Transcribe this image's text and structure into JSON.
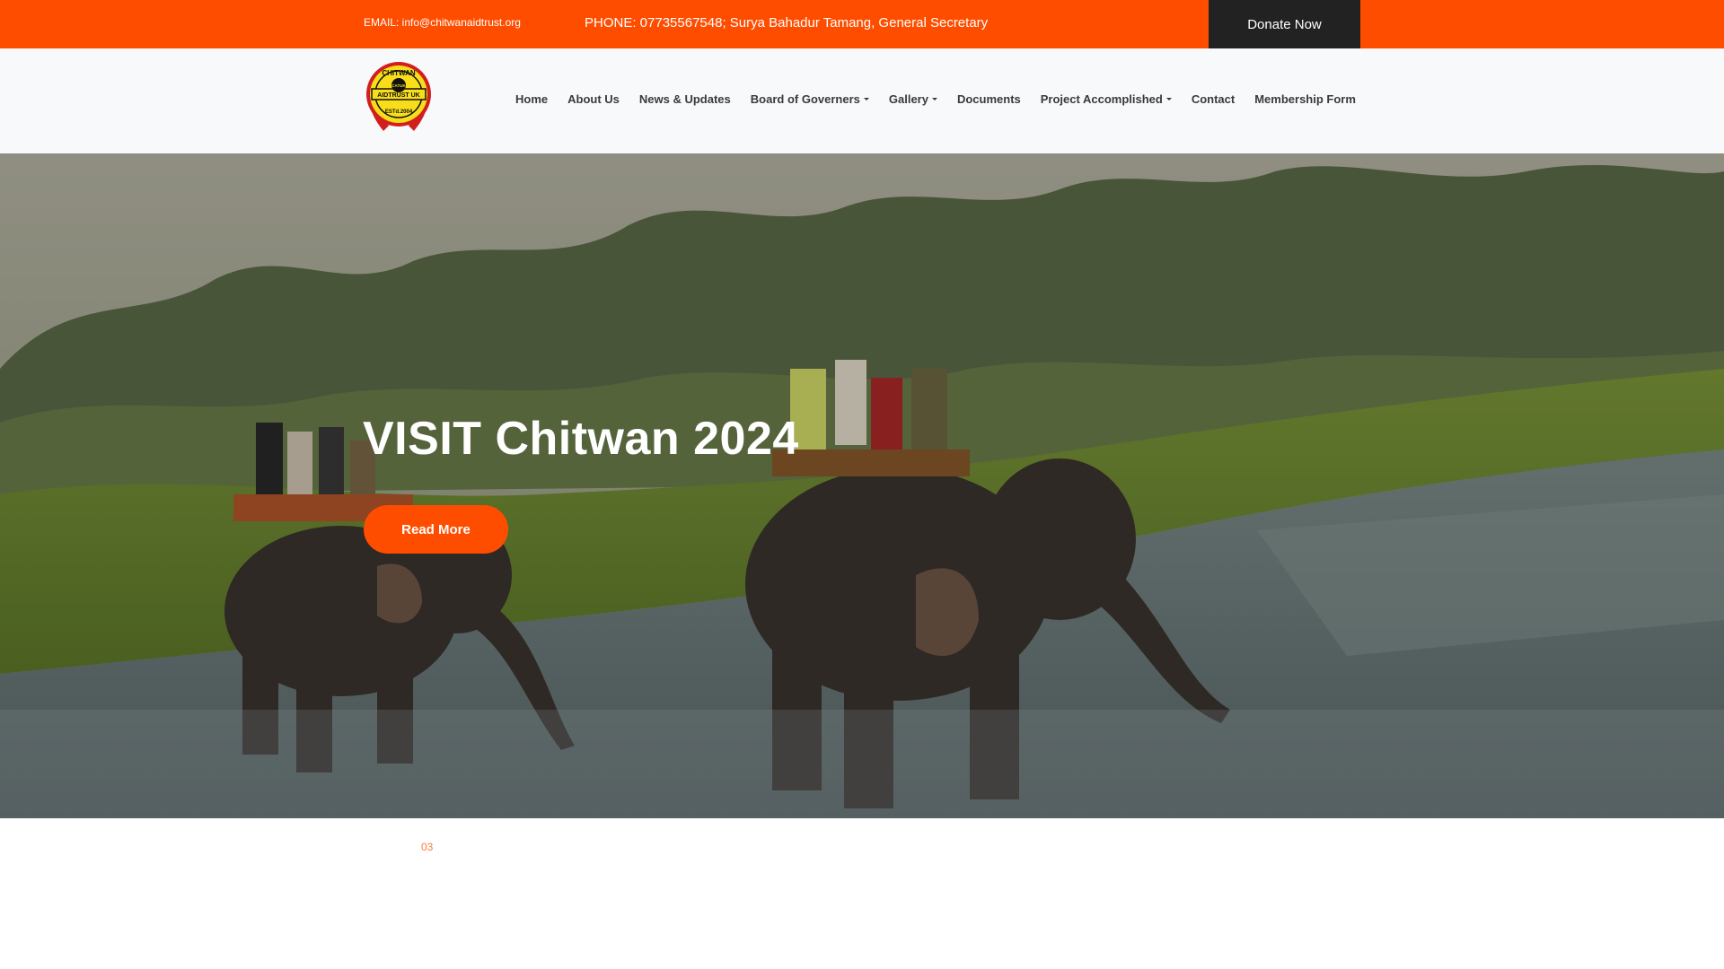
{
  "topbar": {
    "email": "EMAIL: info@chitwanaidtrust.org",
    "phone": "PHONE: 07735567548; Surya Bahadur Tamang, General Secretary",
    "donate_label": "Donate Now"
  },
  "logo": {
    "top_text": "CHITWAN",
    "middle_text": "CATUK",
    "band_text": "AIDTRUST UK",
    "bottom_text": "ESTd.2004"
  },
  "nav": {
    "items": [
      {
        "label": "Home",
        "dropdown": false
      },
      {
        "label": "About Us",
        "dropdown": false
      },
      {
        "label": "News & Updates",
        "dropdown": false
      },
      {
        "label": "Board of Governers",
        "dropdown": true
      },
      {
        "label": "Gallery",
        "dropdown": true
      },
      {
        "label": "Documents",
        "dropdown": false
      },
      {
        "label": "Project Accomplished",
        "dropdown": true
      },
      {
        "label": "Contact",
        "dropdown": false
      },
      {
        "label": "Membership Form",
        "dropdown": false
      }
    ]
  },
  "hero": {
    "title": "VISIT Chitwan 2024",
    "button_label": "Read More"
  },
  "slider": {
    "counter": "03"
  },
  "colors": {
    "accent": "#ff4d00",
    "dark": "#222222",
    "nav_bg": "#f8f9fa"
  }
}
